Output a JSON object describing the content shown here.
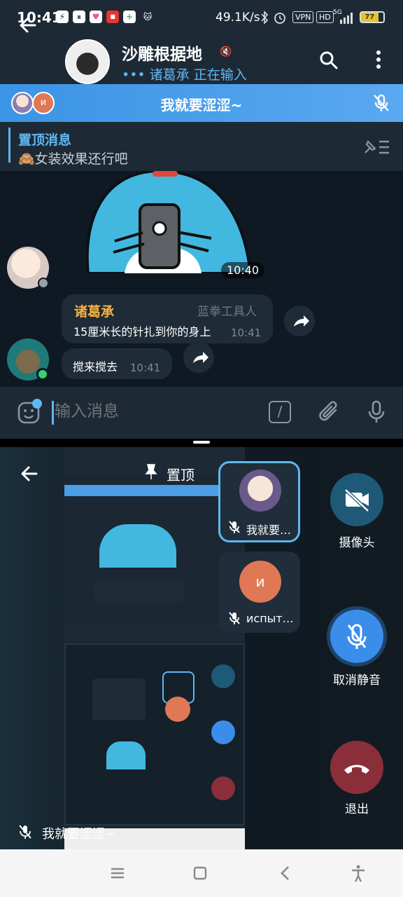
{
  "status_bar": {
    "time": "10:41",
    "network_speed": "49.1K/s",
    "vpn": "VPN",
    "hd": "HD",
    "signal": "5G",
    "battery": "77"
  },
  "header": {
    "title": "沙雕根据地",
    "typing": "••• 诸葛承 正在输入"
  },
  "voice_chat_bar": {
    "title": "我就要涩涩~",
    "avatar_letter": "и"
  },
  "pinned": {
    "title": "置顶消息",
    "text": "🙈女装效果还行吧"
  },
  "messages": [
    {
      "type": "sticker",
      "time": "10:40"
    },
    {
      "sender": "诸葛承",
      "badge": "蓝拳工具人",
      "text": "15厘米长的针扎到你的身上",
      "time": "10:41"
    },
    {
      "text": "搅来搅去",
      "time": "10:41"
    }
  ],
  "input": {
    "placeholder": "输入消息",
    "command_icon": "/"
  },
  "voice_panel": {
    "pin_label": "置顶",
    "participants": [
      {
        "name": "我就要…",
        "muted": true
      },
      {
        "name": "испыт…",
        "letter": "и",
        "muted": true
      }
    ],
    "controls": {
      "camera": "摄像头",
      "unmute": "取消静音",
      "leave": "退出"
    },
    "self_name": "我就要涩涩~"
  },
  "colors": {
    "accent": "#5fb7f2",
    "sender_name": "#f5b03f",
    "leave_red": "#8a2f39",
    "online": "#3bd16f"
  }
}
